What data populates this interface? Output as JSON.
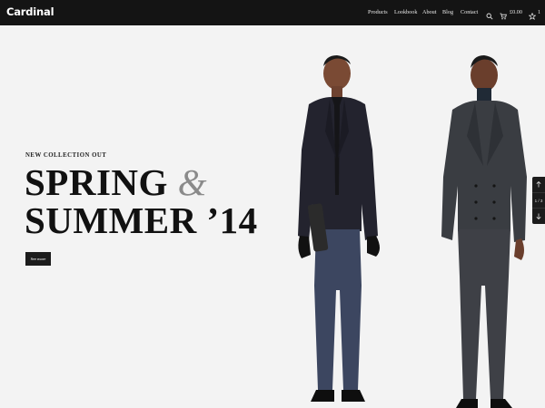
{
  "header": {
    "logo": "Cardinal",
    "nav": [
      "Products",
      "Lookbook",
      "About",
      "Blog",
      "Contact"
    ],
    "cart_total": "£0.00",
    "wishlist_count": "1"
  },
  "hero": {
    "eyebrow": "NEW COLLECTION OUT",
    "headline_line1": "SPRING",
    "headline_amp": "&",
    "headline_line2": "SUMMER ’14",
    "cta_label": "See more"
  },
  "slider": {
    "counter": "1 / 3"
  },
  "icons": {
    "search": "search-icon",
    "cart": "cart-icon",
    "wishlist": "star-icon",
    "up": "arrow-up-icon",
    "down": "arrow-down-icon"
  },
  "colors": {
    "header_bg": "#141414",
    "page_bg": "#f3f3f3",
    "accent_amp": "#8a8a8a",
    "button_bg": "#1c1c1c"
  }
}
